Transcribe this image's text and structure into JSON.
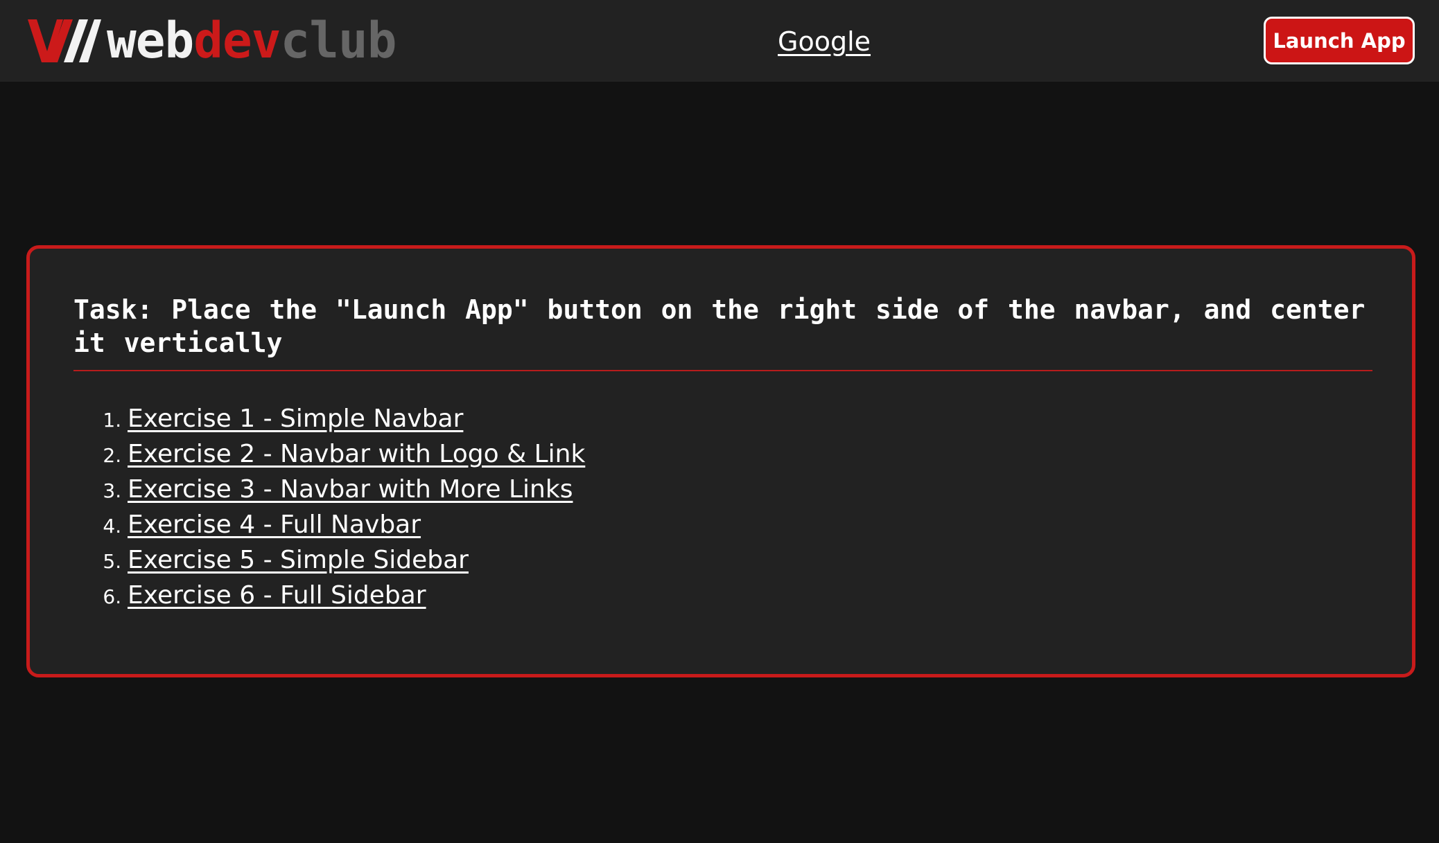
{
  "navbar": {
    "logo": {
      "icon": "webdevclub-slash-logo-icon",
      "text_web": "web",
      "text_dev": "dev",
      "text_club": "club"
    },
    "link_label": "Google",
    "launch_button_label": "Launch App"
  },
  "task": {
    "heading": "Task: Place the \"Launch App\" button on the right side of the navbar, and center it vertically",
    "exercises": [
      {
        "label": "Exercise 1 - Simple Navbar"
      },
      {
        "label": "Exercise 2 - Navbar with Logo & Link"
      },
      {
        "label": "Exercise 3 - Navbar with More Links"
      },
      {
        "label": "Exercise 4 - Full Navbar"
      },
      {
        "label": "Exercise 5 - Simple Sidebar"
      },
      {
        "label": "Exercise 6 - Full Sidebar"
      }
    ]
  },
  "colors": {
    "accent_red": "#cc1515",
    "navbar_bg": "#222222",
    "page_bg": "#121212",
    "card_bg": "#222222",
    "card_border": "#c81b1b"
  }
}
